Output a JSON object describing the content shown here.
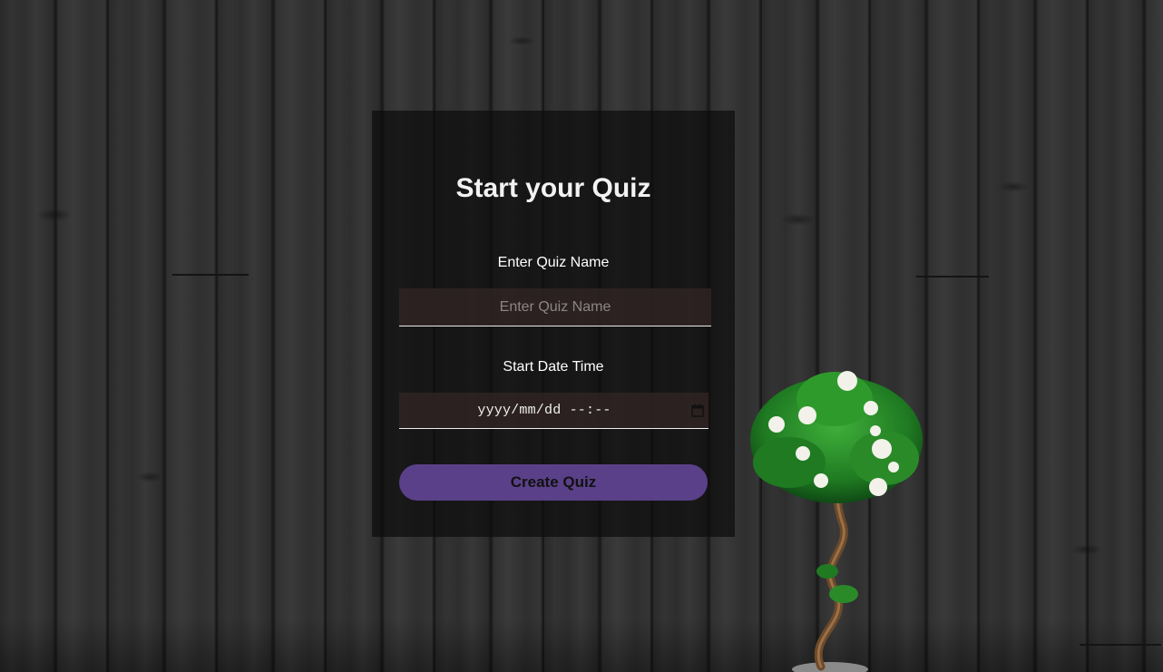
{
  "form": {
    "title": "Start your Quiz",
    "quiz_name_label": "Enter Quiz Name",
    "quiz_name_placeholder": "Enter Quiz Name",
    "quiz_name_value": "",
    "start_label": "Start Date Time",
    "start_value_display": "yyyy/mm/dd --:--",
    "submit_label": "Create Quiz"
  },
  "icons": {
    "calendar": "calendar-icon"
  },
  "colors": {
    "panel_bg": "#0c0c0c",
    "input_bg": "#342626",
    "button_bg": "#5a4088",
    "text": "#ffffff"
  }
}
